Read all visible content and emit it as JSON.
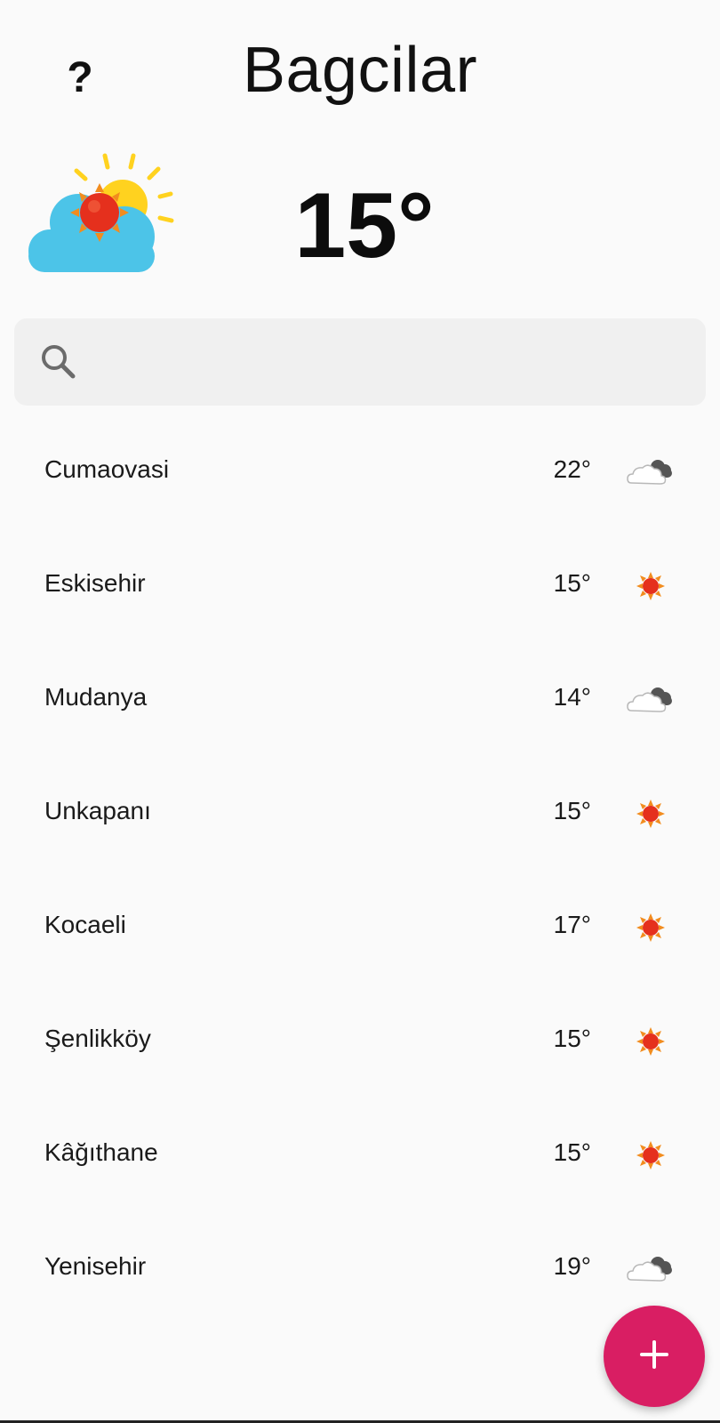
{
  "header": {
    "help_label": "?",
    "help_icon": "question-icon",
    "city": "Bagcilar"
  },
  "current": {
    "temperature": "15°",
    "condition_icon": "sun-behind-cloud-icon"
  },
  "search": {
    "icon": "search-icon",
    "placeholder": "",
    "value": ""
  },
  "cities": [
    {
      "name": "Cumaovasi",
      "temp": "22°",
      "icon": "cloud-icon"
    },
    {
      "name": "Eskisehir",
      "temp": "15°",
      "icon": "sun-icon"
    },
    {
      "name": "Mudanya",
      "temp": "14°",
      "icon": "cloud-icon"
    },
    {
      "name": "Unkapanı",
      "temp": "15°",
      "icon": "sun-icon"
    },
    {
      "name": "Kocaeli",
      "temp": "17°",
      "icon": "sun-icon"
    },
    {
      "name": "Şenlikköy",
      "temp": "15°",
      "icon": "sun-icon"
    },
    {
      "name": "Kâğıthane",
      "temp": "15°",
      "icon": "sun-icon"
    },
    {
      "name": "Yenisehir",
      "temp": "19°",
      "icon": "cloud-icon"
    }
  ],
  "fab": {
    "icon": "plus-icon",
    "color": "#d91e63"
  },
  "colors": {
    "background": "#fafafa",
    "search_bg": "#f0f0f0",
    "cloud_blue": "#4cc4e8",
    "sun_red": "#e5301d",
    "sun_yellow": "#ffd21f"
  }
}
